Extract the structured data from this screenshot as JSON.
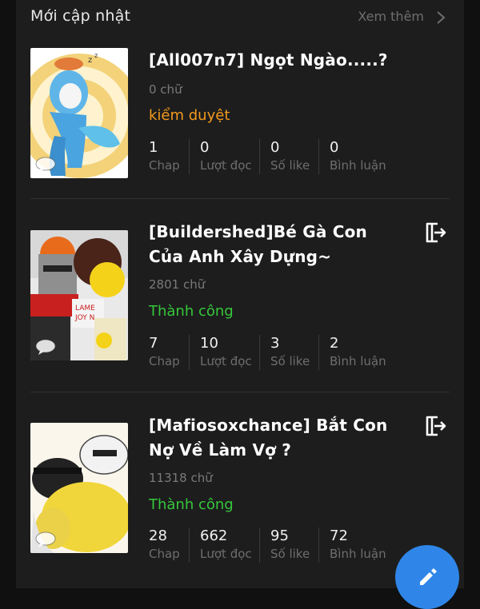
{
  "header": {
    "title": "Mới cập nhật",
    "more_label": "Xem thêm"
  },
  "stories": [
    {
      "title": "[All007n7] Ngọt Ngào.....?",
      "words": "0 chữ",
      "status": "kiểm duyệt",
      "status_color": "#f39a1d",
      "stats": [
        {
          "value": "1",
          "label": "Chap"
        },
        {
          "value": "0",
          "label": "Lượt đọc"
        },
        {
          "value": "0",
          "label": "Số like"
        },
        {
          "value": "0",
          "label": "Bình luận"
        }
      ]
    },
    {
      "title": "[Buildershed]Bé Gà Con Của Anh Xây Dựng~",
      "words": "2801 chữ",
      "status": "Thành công",
      "status_color": "#36c73c",
      "stats": [
        {
          "value": "7",
          "label": "Chap"
        },
        {
          "value": "10",
          "label": "Lượt đọc"
        },
        {
          "value": "3",
          "label": "Số like"
        },
        {
          "value": "2",
          "label": "Bình luận"
        }
      ]
    },
    {
      "title": "[Mafiosoxchance] Bắt Con Nợ Về Làm Vợ ?",
      "words": "11318 chữ",
      "status": "Thành công",
      "status_color": "#36c73c",
      "stats": [
        {
          "value": "28",
          "label": "Chap"
        },
        {
          "value": "662",
          "label": "Lượt đọc"
        },
        {
          "value": "95",
          "label": "Số like"
        },
        {
          "value": "72",
          "label": "Bình luận"
        }
      ]
    }
  ],
  "icons": {
    "more": "chevron-right-icon",
    "exit": "exit-icon",
    "fab": "pencil-icon",
    "cover_badge": "comment-bubble-icon"
  },
  "colors": {
    "background": "#1d1d1d",
    "accent": "#2f86e8",
    "pending": "#f39a1d",
    "success": "#36c73c"
  }
}
